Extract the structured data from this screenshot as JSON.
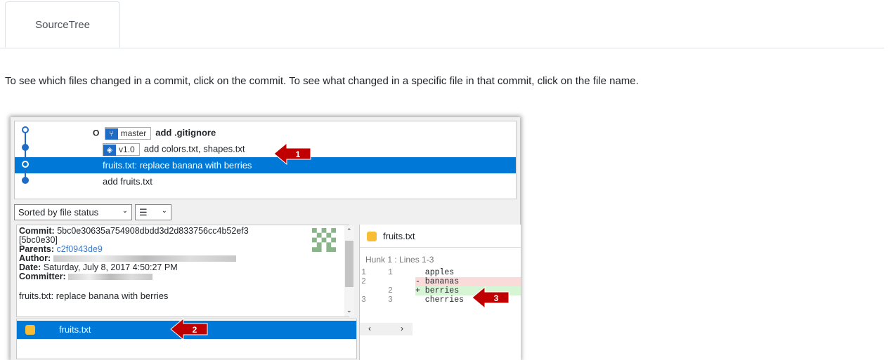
{
  "tabs": [
    {
      "label": "SourceTree"
    }
  ],
  "intro": "To see which files changed in a commit, click on the commit. To see what changed in a specific file in that commit, click on the file name.",
  "history": {
    "rows": [
      {
        "branch": "master",
        "message": "add .gitignore"
      },
      {
        "tag": "v1.0",
        "message": "add colors.txt, shapes.txt"
      },
      {
        "message": "fruits.txt: replace banana with berries"
      },
      {
        "message": "add fruits.txt"
      }
    ]
  },
  "toolbar": {
    "sort_label": "Sorted by file status",
    "view_icon": "list-view-icon"
  },
  "commit": {
    "commit_label": "Commit:",
    "hash": "5bc0e30635a754908dbdd3d2d833756cc4b52ef3",
    "short_hash": "[5bc0e30]",
    "parents_label": "Parents:",
    "parent": "c2f0943de9",
    "author_label": "Author:",
    "date_label": "Date:",
    "date": "Saturday, July 8, 2017 4:50:27 PM",
    "committer_label": "Committer:",
    "message": "fruits.txt: replace banana with berries"
  },
  "files": [
    {
      "name": "fruits.txt"
    }
  ],
  "diff": {
    "file": "fruits.txt",
    "hunk": "Hunk 1 : Lines 1-3",
    "lines": [
      {
        "old": "1",
        "new": "1",
        "text": "  apples"
      },
      {
        "old": "2",
        "new": "",
        "text": "- bananas"
      },
      {
        "old": "",
        "new": "2",
        "text": "+ berries"
      },
      {
        "old": "3",
        "new": "3",
        "text": "  cherries"
      }
    ]
  },
  "annotations": [
    "1",
    "2",
    "3"
  ],
  "colors": {
    "selection": "#0078d7",
    "arrow": "#c00000",
    "graph": "#1f6cc6"
  }
}
